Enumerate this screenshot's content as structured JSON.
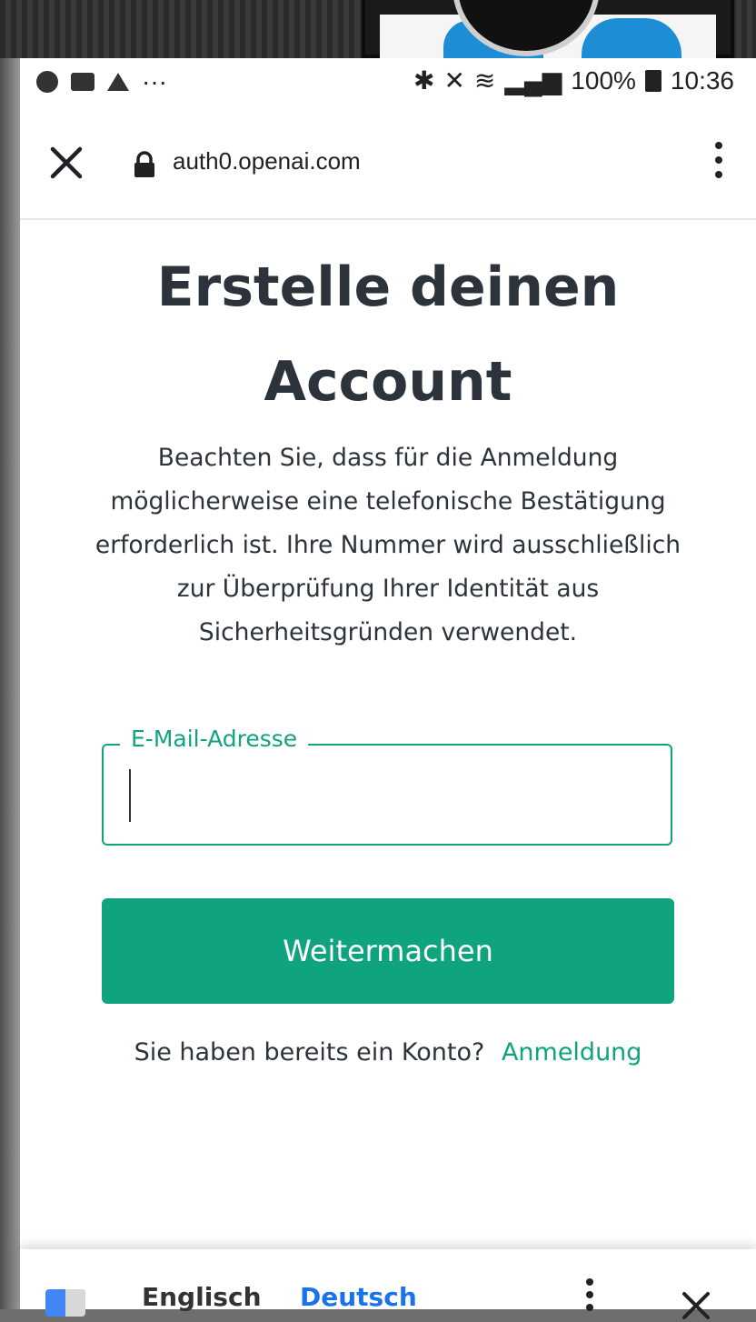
{
  "status_bar": {
    "icons_left": [
      "notification-icon",
      "activity-icon",
      "alert-icon",
      "more-icon"
    ],
    "more": "···",
    "battery": "100%",
    "time": "10:36"
  },
  "browser": {
    "url": "auth0.openai.com"
  },
  "page": {
    "title": "Erstelle deinen\nAccount",
    "subtitle": "Beachten Sie, dass für die Anmeldung möglicherweise eine telefonische Bestätigung erforderlich ist. Ihre Nummer wird ausschließlich zur Überprüfung Ihrer Identität aus Sicherheitsgründen verwendet.",
    "email_label": "E-Mail-Adresse",
    "email_value": "",
    "continue_label": "Weitermachen",
    "signin_prompt": "Sie haben bereits ein Konto?",
    "signin_link": "Anmeldung"
  },
  "translate_bar": {
    "source_lang": "Englisch",
    "target_lang": "Deutsch"
  },
  "colors": {
    "accent": "#10a37f",
    "text": "#2d333a",
    "link_blue": "#1a73e8"
  }
}
